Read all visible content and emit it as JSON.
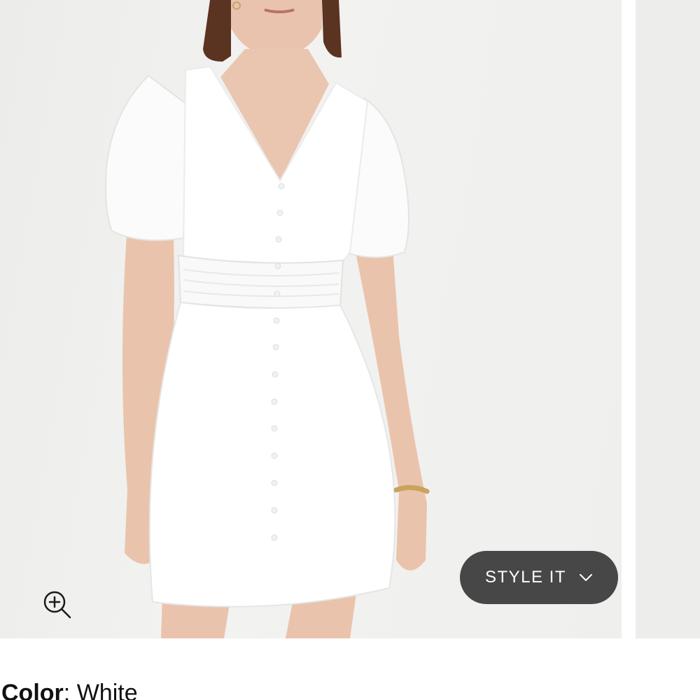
{
  "product_image": {
    "alt": "White button-front puff sleeve dress",
    "zoom_icon": "zoom-in-icon"
  },
  "style_it": {
    "label": "STYLE IT",
    "icon": "chevron-down-icon",
    "background": "#474747"
  },
  "color_selector": {
    "key": "Color",
    "separator": ": ",
    "value": "White"
  }
}
